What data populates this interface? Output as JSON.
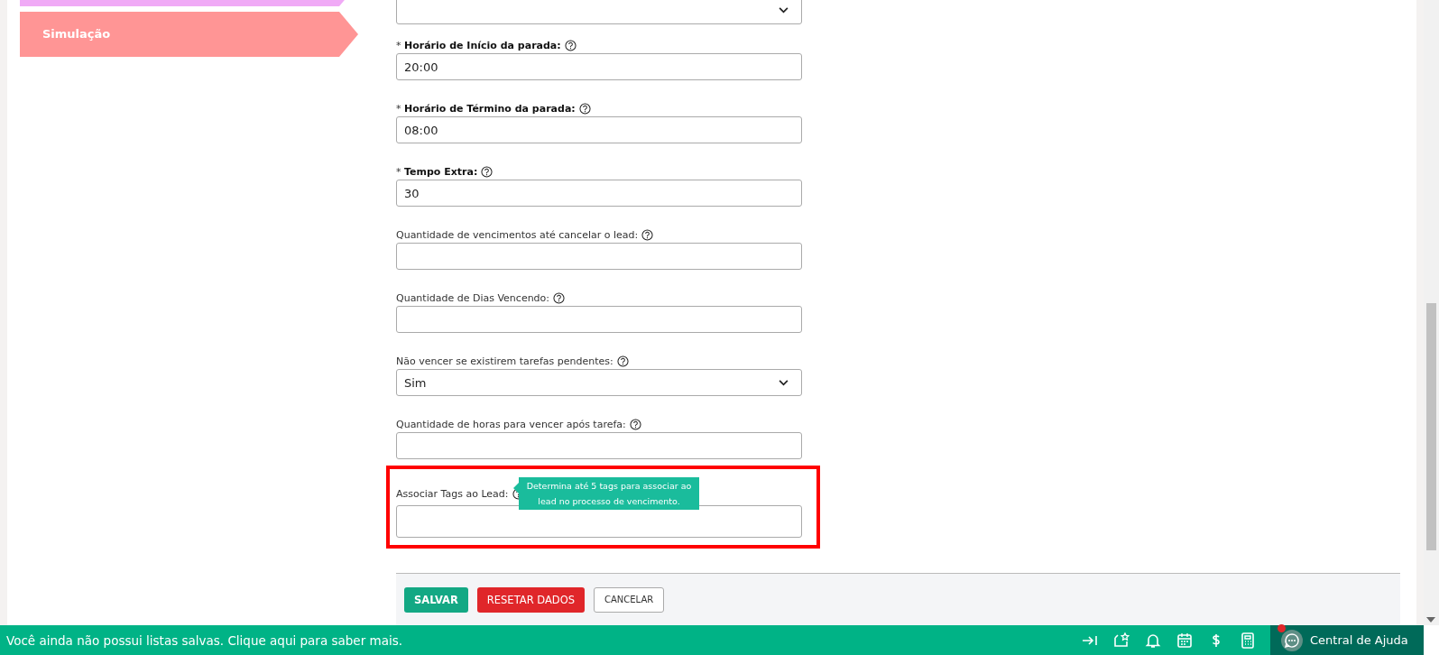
{
  "sidebar": {
    "items": [
      {
        "color": "#f0aaf6"
      },
      {
        "label": "Simulação",
        "color": "#ff9595"
      }
    ]
  },
  "form": {
    "fields": [
      {
        "kind": "select",
        "highlighted": false
      },
      {
        "kind": "text",
        "label": "* **Horário de Início da parada:**",
        "value": "20:00",
        "highlighted": false
      },
      {
        "kind": "text",
        "label": "* **Horário de Término da parada:**",
        "value": "08:00",
        "highlighted": false
      },
      {
        "kind": "text",
        "label": "* **Tempo Extra:**",
        "value": "30",
        "highlighted": false
      },
      {
        "kind": "text",
        "label": "Quantidade de vencimentos até cancelar o lead:",
        "highlighted": false
      },
      {
        "kind": "text",
        "label": "Quantidade de Dias Vencendo:",
        "highlighted": false
      },
      {
        "kind": "select",
        "label": "Não vencer se existirem tarefas pendentes:",
        "value": "Sim",
        "highlighted": false
      },
      {
        "kind": "text",
        "label": "Quantidade de horas para vencer após tarefa:",
        "highlighted": false
      },
      {
        "kind": "text",
        "label": "Associar Tags ao Lead:",
        "highlighted": true,
        "tooltip": "Determina até 5 tags para associar ao lead no processo de vencimento."
      }
    ],
    "buttons": [
      {
        "label": "SALVAR",
        "kind": "primary"
      },
      {
        "label": "RESETAR DADOS",
        "kind": "danger"
      },
      {
        "label": "CANCELAR",
        "kind": "default"
      }
    ]
  },
  "status_bar": {
    "message": "Você ainda não possui listas salvas. Clique aqui para saber mais.",
    "help": {
      "label": "Central de Ajuda",
      "notification": true
    }
  }
}
